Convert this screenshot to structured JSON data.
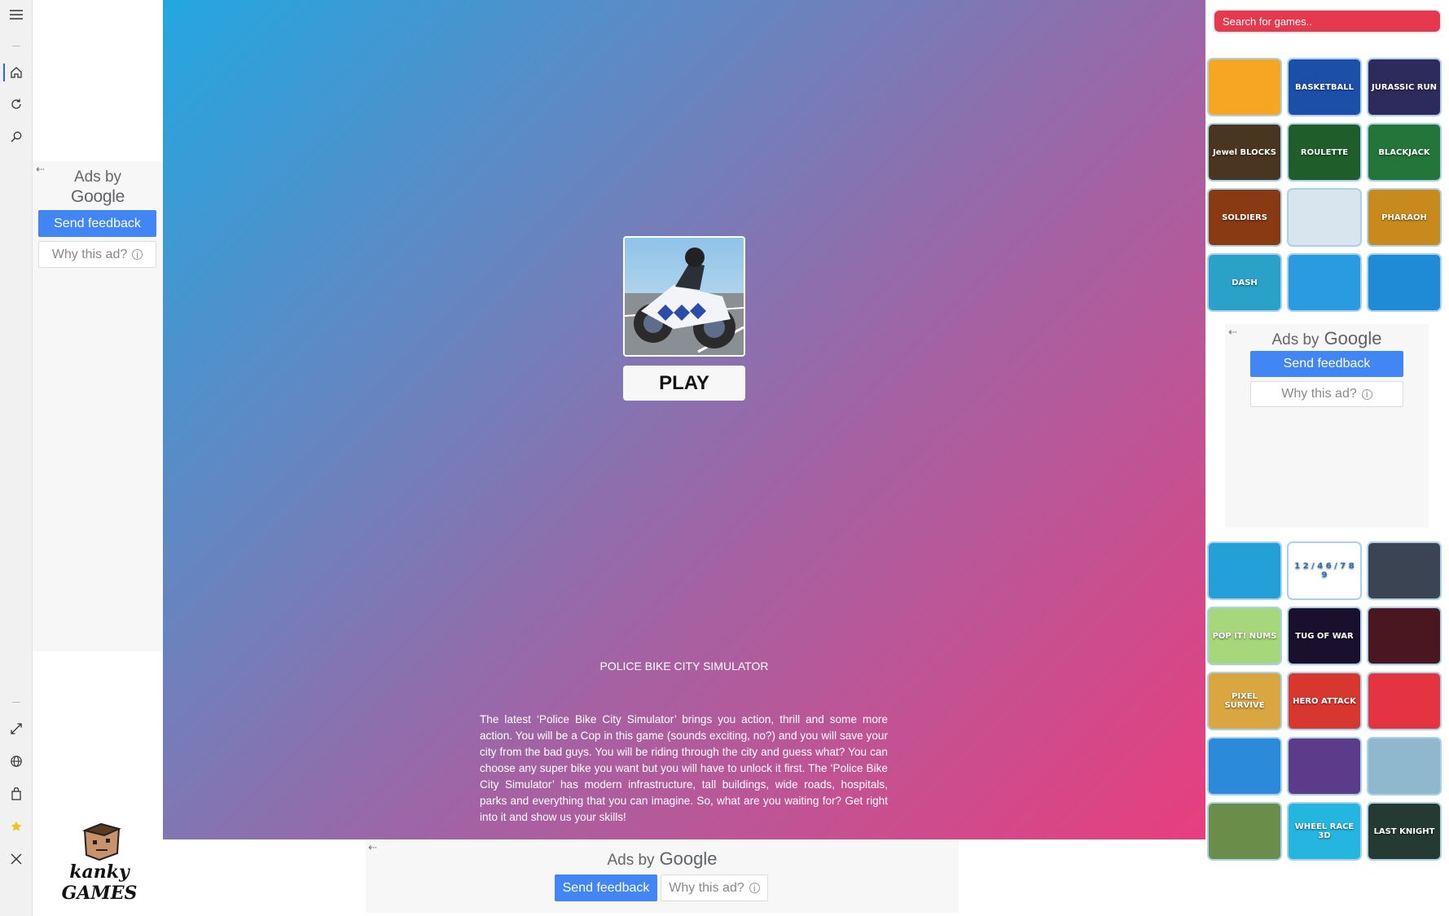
{
  "rail": {
    "icons": [
      "menu-icon",
      "home-icon",
      "refresh-icon",
      "search-icon",
      "expand-icon",
      "globe-icon",
      "bag-icon",
      "star-icon",
      "close-icon"
    ]
  },
  "left_ad": {
    "ads_by": "Ads by",
    "google": "Google",
    "send_feedback": "Send feedback",
    "why_this_ad": "Why this ad?"
  },
  "logo": {
    "line1": "kanky",
    "line2": "GAMES"
  },
  "game": {
    "play_label": "PLAY",
    "title": "POLICE BIKE CITY SIMULATOR",
    "description": "The latest ‘Police Bike City Simulator’ brings you action, thrill and some more action. You will be a Cop in this game (sounds exciting, no?) and you will save your city from the bad guys. You will be riding through the city and guess what? You can choose any super bike you want but you will have to unlock it first. The ‘Police Bike City Simulator’ has modern infrastructure, tall buildings, wide roads, hospitals, parks and everything that you can imagine. So, what are you waiting for? Get right into it and show us your skills!"
  },
  "bottom_ad": {
    "ads_by": "Ads by",
    "google": "Google",
    "send_feedback": "Send feedback",
    "why_this_ad": "Why this ad?"
  },
  "right_ad": {
    "ads_by": "Ads by",
    "google": "Google",
    "send_feedback": "Send feedback",
    "why_this_ad": "Why this ad?"
  },
  "search": {
    "placeholder": "Search for games.."
  },
  "tiles_top": [
    {
      "label": "",
      "bg": "#f6a623"
    },
    {
      "label": "BASKETBALL",
      "bg": "#1b4fa8"
    },
    {
      "label": "JURASSIC RUN",
      "bg": "#2d2b5c"
    },
    {
      "label": "Jewel BLOCKS",
      "bg": "#4a3520"
    },
    {
      "label": "ROULETTE",
      "bg": "#1f5e2b"
    },
    {
      "label": "BLACKJACK",
      "bg": "#23753a"
    },
    {
      "label": "SOLDIERS",
      "bg": "#8a3a12"
    },
    {
      "label": "",
      "bg": "#d8e4ee"
    },
    {
      "label": "PHARAOH",
      "bg": "#c88a1c"
    },
    {
      "label": "DASH",
      "bg": "#2aa1c9"
    },
    {
      "label": "",
      "bg": "#2a9be0"
    },
    {
      "label": "",
      "bg": "#1f8ad6"
    }
  ],
  "tiles_bottom": [
    {
      "label": "",
      "bg": "#23a0d8"
    },
    {
      "label": "1 2 / 4 6 / 7 8 9",
      "bg": "#ffffff"
    },
    {
      "label": "",
      "bg": "#3b4452"
    },
    {
      "label": "POP IT! NUMS",
      "bg": "#a6d77a"
    },
    {
      "label": "TUG OF WAR",
      "bg": "#1b0f2e"
    },
    {
      "label": "",
      "bg": "#4a1620"
    },
    {
      "label": "PIXEL SURVIVE",
      "bg": "#d9a640"
    },
    {
      "label": "HERO ATTACK",
      "bg": "#d8372f"
    },
    {
      "label": "",
      "bg": "#e43442"
    },
    {
      "label": "",
      "bg": "#2b8ad9"
    },
    {
      "label": "",
      "bg": "#5c3b8a"
    },
    {
      "label": "",
      "bg": "#8fb8cf"
    },
    {
      "label": "",
      "bg": "#6b8d4a"
    },
    {
      "label": "WHEEL RACE 3D",
      "bg": "#25b6e0"
    },
    {
      "label": "LAST KNIGHT",
      "bg": "#243a32"
    }
  ]
}
